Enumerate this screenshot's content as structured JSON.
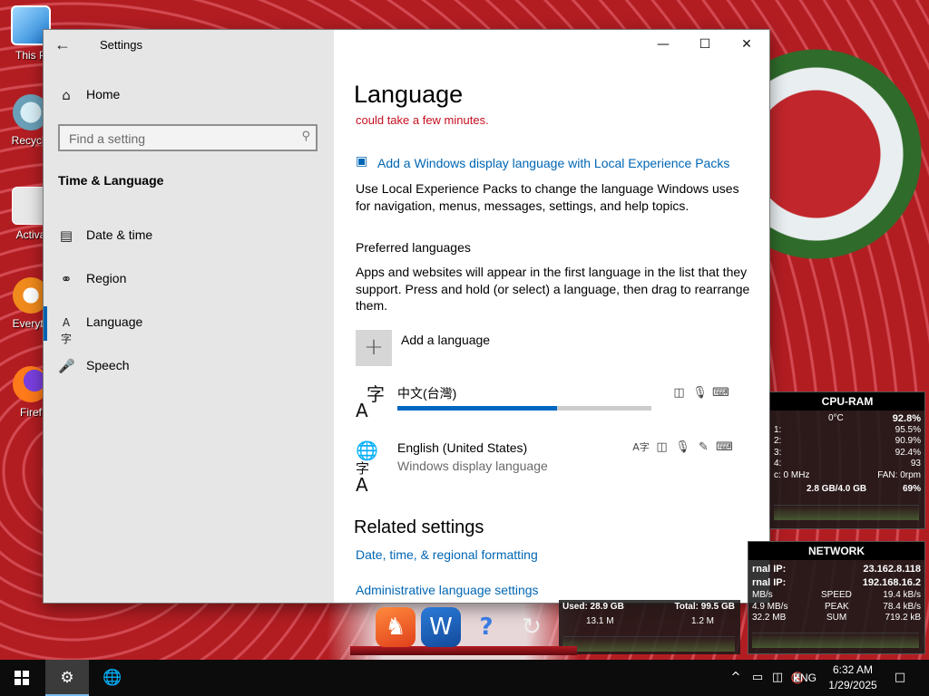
{
  "desktop": {
    "icons": [
      {
        "label": "This P"
      },
      {
        "label": "Recycle"
      },
      {
        "label": "Activa"
      },
      {
        "label": "Everyth"
      },
      {
        "label": "Firef"
      }
    ]
  },
  "window": {
    "title": "Settings",
    "back_icon": "back-arrow-icon",
    "controls": {
      "minimize": "—",
      "maximize": "☐",
      "close": "✕"
    }
  },
  "nav": {
    "home_label": "Home",
    "home_icon": "home-icon",
    "search_placeholder": "Find a setting",
    "section_title": "Time & Language",
    "items": [
      {
        "label": "Date & time",
        "icon": "calendar-clock-icon",
        "active": false
      },
      {
        "label": "Region",
        "icon": "globe-icon",
        "active": false
      },
      {
        "label": "Language",
        "icon": "language-icon",
        "active": true
      },
      {
        "label": "Speech",
        "icon": "microphone-icon",
        "active": false
      }
    ]
  },
  "main": {
    "title": "Language",
    "warning": "could take a few minutes.",
    "lxp_link": "Add a Windows display language with Local Experience Packs",
    "lxp_desc": "Use Local Experience Packs to change the language Windows uses for navigation, menus, messages, settings, and help topics.",
    "preferred_heading": "Preferred languages",
    "preferred_desc": "Apps and websites will appear in the first language in the list that they support. Press and hold (or select) a language, then drag to rearrange them.",
    "add_language_label": "Add a language",
    "languages": [
      {
        "name": "中文(台灣)",
        "subtitle": "",
        "progress": 0.63,
        "capability_icons": [
          "display-language-icon",
          "speech-icon",
          "keyboard-icon"
        ]
      },
      {
        "name": "English (United States)",
        "subtitle": "Windows display language",
        "capability_icons": [
          "text-to-speech-icon",
          "display-language-icon",
          "speech-icon",
          "handwriting-icon",
          "keyboard-icon"
        ]
      }
    ],
    "related_heading": "Related settings",
    "related_links": [
      "Date, time, & regional formatting",
      "Administrative language settings"
    ]
  },
  "cpu_gadget": {
    "title": "CPU-RAM",
    "temp": "0°C",
    "total": "92.8%",
    "cores": [
      {
        "label": "1:",
        "value": "95.5%"
      },
      {
        "label": "2:",
        "value": "90.9%"
      },
      {
        "label": "3:",
        "value": "92.4%"
      },
      {
        "label": "4:",
        "value": "93"
      }
    ],
    "clock": "c: 0 MHz",
    "fan": "FAN: 0rpm",
    "ram": "2.8 GB/4.0 GB",
    "ram_pct": "69%"
  },
  "network_gadget": {
    "title": "NETWORK",
    "external_label": "rnal IP:",
    "external_ip": "23.162.8.118",
    "internal_label": "rnal IP:",
    "internal_ip": "192.168.16.2",
    "rows": [
      {
        "left": "MB/s",
        "mid": "SPEED",
        "right": "19.4 kB/s"
      },
      {
        "left": "4.9 MB/s",
        "mid": "PEAK",
        "right": "78.4 kB/s"
      },
      {
        "left": "32.2 MB",
        "mid": "SUM",
        "right": "719.2 kB"
      }
    ]
  },
  "drive_gadget": {
    "used": "Used: 28.9 GB",
    "total": "Total: 99.5 GB",
    "left_val": "13.1 M",
    "right_val": "1.2 M"
  },
  "dock": {
    "apps": [
      "brave-icon",
      "wise-care-icon",
      "help-icon",
      "sync-icon"
    ]
  },
  "taskbar": {
    "start_icon": "windows-logo-icon",
    "apps": [
      "settings-gear-icon",
      "network-globe-icon"
    ],
    "tray": {
      "chevron": "^",
      "icons": [
        "notes-icon",
        "network-icon",
        "volume-muted-icon"
      ],
      "lang": "ENG",
      "time": "6:32 AM",
      "date": "1/29/2025",
      "notifications_icon": "action-center-icon"
    }
  },
  "colors": {
    "accent": "#0067c0",
    "link": "#0066b4",
    "warning": "#c50f1f",
    "nav_bg": "#e6e6e6"
  }
}
